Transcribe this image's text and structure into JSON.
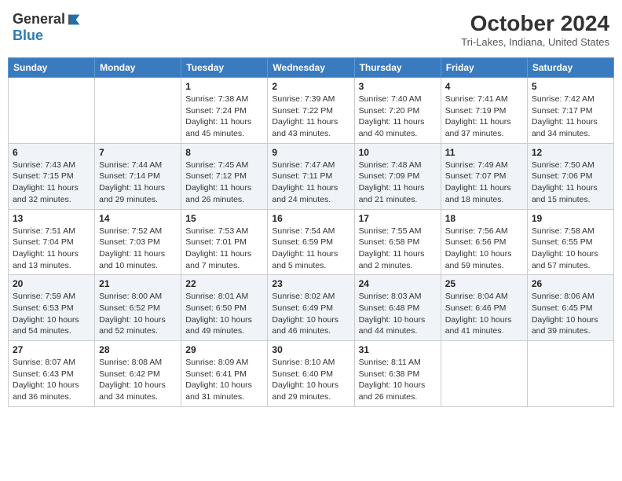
{
  "header": {
    "logo_general": "General",
    "logo_blue": "Blue",
    "month_title": "October 2024",
    "location": "Tri-Lakes, Indiana, United States"
  },
  "weekdays": [
    "Sunday",
    "Monday",
    "Tuesday",
    "Wednesday",
    "Thursday",
    "Friday",
    "Saturday"
  ],
  "weeks": [
    [
      {
        "day": "",
        "info": ""
      },
      {
        "day": "",
        "info": ""
      },
      {
        "day": "1",
        "info": "Sunrise: 7:38 AM\nSunset: 7:24 PM\nDaylight: 11 hours and 45 minutes."
      },
      {
        "day": "2",
        "info": "Sunrise: 7:39 AM\nSunset: 7:22 PM\nDaylight: 11 hours and 43 minutes."
      },
      {
        "day": "3",
        "info": "Sunrise: 7:40 AM\nSunset: 7:20 PM\nDaylight: 11 hours and 40 minutes."
      },
      {
        "day": "4",
        "info": "Sunrise: 7:41 AM\nSunset: 7:19 PM\nDaylight: 11 hours and 37 minutes."
      },
      {
        "day": "5",
        "info": "Sunrise: 7:42 AM\nSunset: 7:17 PM\nDaylight: 11 hours and 34 minutes."
      }
    ],
    [
      {
        "day": "6",
        "info": "Sunrise: 7:43 AM\nSunset: 7:15 PM\nDaylight: 11 hours and 32 minutes."
      },
      {
        "day": "7",
        "info": "Sunrise: 7:44 AM\nSunset: 7:14 PM\nDaylight: 11 hours and 29 minutes."
      },
      {
        "day": "8",
        "info": "Sunrise: 7:45 AM\nSunset: 7:12 PM\nDaylight: 11 hours and 26 minutes."
      },
      {
        "day": "9",
        "info": "Sunrise: 7:47 AM\nSunset: 7:11 PM\nDaylight: 11 hours and 24 minutes."
      },
      {
        "day": "10",
        "info": "Sunrise: 7:48 AM\nSunset: 7:09 PM\nDaylight: 11 hours and 21 minutes."
      },
      {
        "day": "11",
        "info": "Sunrise: 7:49 AM\nSunset: 7:07 PM\nDaylight: 11 hours and 18 minutes."
      },
      {
        "day": "12",
        "info": "Sunrise: 7:50 AM\nSunset: 7:06 PM\nDaylight: 11 hours and 15 minutes."
      }
    ],
    [
      {
        "day": "13",
        "info": "Sunrise: 7:51 AM\nSunset: 7:04 PM\nDaylight: 11 hours and 13 minutes."
      },
      {
        "day": "14",
        "info": "Sunrise: 7:52 AM\nSunset: 7:03 PM\nDaylight: 11 hours and 10 minutes."
      },
      {
        "day": "15",
        "info": "Sunrise: 7:53 AM\nSunset: 7:01 PM\nDaylight: 11 hours and 7 minutes."
      },
      {
        "day": "16",
        "info": "Sunrise: 7:54 AM\nSunset: 6:59 PM\nDaylight: 11 hours and 5 minutes."
      },
      {
        "day": "17",
        "info": "Sunrise: 7:55 AM\nSunset: 6:58 PM\nDaylight: 11 hours and 2 minutes."
      },
      {
        "day": "18",
        "info": "Sunrise: 7:56 AM\nSunset: 6:56 PM\nDaylight: 10 hours and 59 minutes."
      },
      {
        "day": "19",
        "info": "Sunrise: 7:58 AM\nSunset: 6:55 PM\nDaylight: 10 hours and 57 minutes."
      }
    ],
    [
      {
        "day": "20",
        "info": "Sunrise: 7:59 AM\nSunset: 6:53 PM\nDaylight: 10 hours and 54 minutes."
      },
      {
        "day": "21",
        "info": "Sunrise: 8:00 AM\nSunset: 6:52 PM\nDaylight: 10 hours and 52 minutes."
      },
      {
        "day": "22",
        "info": "Sunrise: 8:01 AM\nSunset: 6:50 PM\nDaylight: 10 hours and 49 minutes."
      },
      {
        "day": "23",
        "info": "Sunrise: 8:02 AM\nSunset: 6:49 PM\nDaylight: 10 hours and 46 minutes."
      },
      {
        "day": "24",
        "info": "Sunrise: 8:03 AM\nSunset: 6:48 PM\nDaylight: 10 hours and 44 minutes."
      },
      {
        "day": "25",
        "info": "Sunrise: 8:04 AM\nSunset: 6:46 PM\nDaylight: 10 hours and 41 minutes."
      },
      {
        "day": "26",
        "info": "Sunrise: 8:06 AM\nSunset: 6:45 PM\nDaylight: 10 hours and 39 minutes."
      }
    ],
    [
      {
        "day": "27",
        "info": "Sunrise: 8:07 AM\nSunset: 6:43 PM\nDaylight: 10 hours and 36 minutes."
      },
      {
        "day": "28",
        "info": "Sunrise: 8:08 AM\nSunset: 6:42 PM\nDaylight: 10 hours and 34 minutes."
      },
      {
        "day": "29",
        "info": "Sunrise: 8:09 AM\nSunset: 6:41 PM\nDaylight: 10 hours and 31 minutes."
      },
      {
        "day": "30",
        "info": "Sunrise: 8:10 AM\nSunset: 6:40 PM\nDaylight: 10 hours and 29 minutes."
      },
      {
        "day": "31",
        "info": "Sunrise: 8:11 AM\nSunset: 6:38 PM\nDaylight: 10 hours and 26 minutes."
      },
      {
        "day": "",
        "info": ""
      },
      {
        "day": "",
        "info": ""
      }
    ]
  ]
}
